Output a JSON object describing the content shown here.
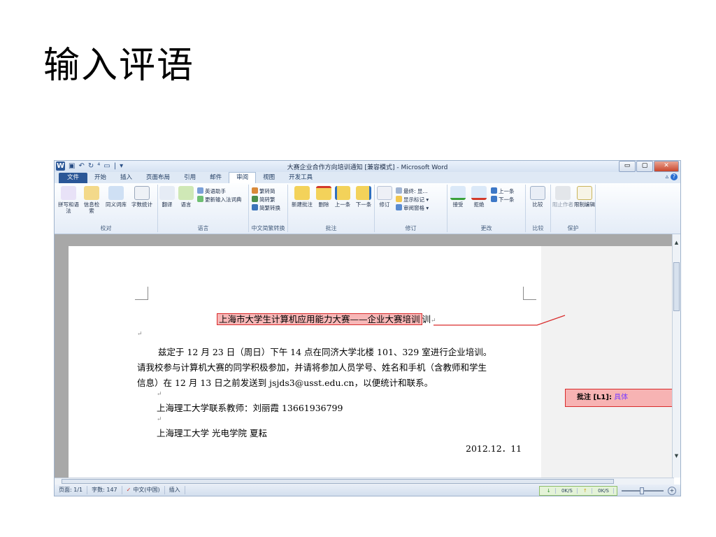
{
  "slide": {
    "title": "输入评语"
  },
  "window": {
    "title": "大赛企业合作方向培训通知 [兼容模式] - Microsoft Word",
    "qat": [
      "W",
      "▣",
      "↶",
      "↻",
      "⁴",
      "▭",
      "|",
      "▾"
    ],
    "controls": [
      "▭",
      "▢",
      "✕"
    ]
  },
  "tabs": [
    "文件",
    "开始",
    "插入",
    "页面布局",
    "引用",
    "邮件",
    "审阅",
    "视图",
    "开发工具"
  ],
  "active_tab": "审阅",
  "ribbon": {
    "proofing": {
      "label": "校对",
      "buttons": [
        "拼写和语法",
        "信息检索",
        "同义词库",
        "字数统计"
      ]
    },
    "language": {
      "label": "语言",
      "buttons": [
        "翻译",
        "语言"
      ],
      "small": [
        "英语助手",
        "更新输入法词典"
      ]
    },
    "chinese": {
      "label": "中文简繁转换",
      "small": [
        "繁转简",
        "简转繁",
        "简繁转换"
      ]
    },
    "comments": {
      "label": "批注",
      "buttons": [
        "新建批注",
        "删除",
        "上一条",
        "下一条"
      ]
    },
    "tracking": {
      "label": "修订",
      "buttons": [
        "修订"
      ],
      "small": [
        "最终: 显...",
        "显示标记 ▾",
        "审阅窗格 ▾"
      ]
    },
    "changes": {
      "label": "更改",
      "buttons": [
        "接受",
        "拒绝"
      ],
      "small": [
        "上一条",
        "下一条"
      ]
    },
    "compare": {
      "label": "比较",
      "buttons": [
        "比较"
      ]
    },
    "protect": {
      "label": "保护",
      "buttons": [
        "阻止作者",
        "限制编辑"
      ]
    }
  },
  "document": {
    "heading": "上海市大学生计算机应用能力大赛——企业大赛培训",
    "para1_line1": "兹定于 12 月 23 日（周日）下午 14 点在同济大学北楼 101、329 室进行企业培训。",
    "para1_line2": "请我校参与计算机大赛的同学积极参加，并请将参加人员学号、姓名和手机（含教师和学生",
    "para1_line3": "信息）在 12 月 13 日之前发送到 jsjds3@usst.edu.cn，以便统计和联系。",
    "contact": "上海理工大学联系教师：刘丽霞  13661936799",
    "sender": "上海理工大学   光电学院   夏耘",
    "date": "2012.12．11",
    "para_mark": "↵"
  },
  "comment": {
    "label": "批注 [L1]:",
    "text": "具体"
  },
  "statusbar": {
    "items": [
      "页面: 1/1",
      "字数: 147",
      "中文(中国)",
      "插入"
    ],
    "net_down": "0K/S",
    "net_up": "0K/S"
  },
  "colors": {
    "file_tab": "#2b5797",
    "comment_fill": "#f7b3b3",
    "comment_border": "#d92c2c"
  }
}
